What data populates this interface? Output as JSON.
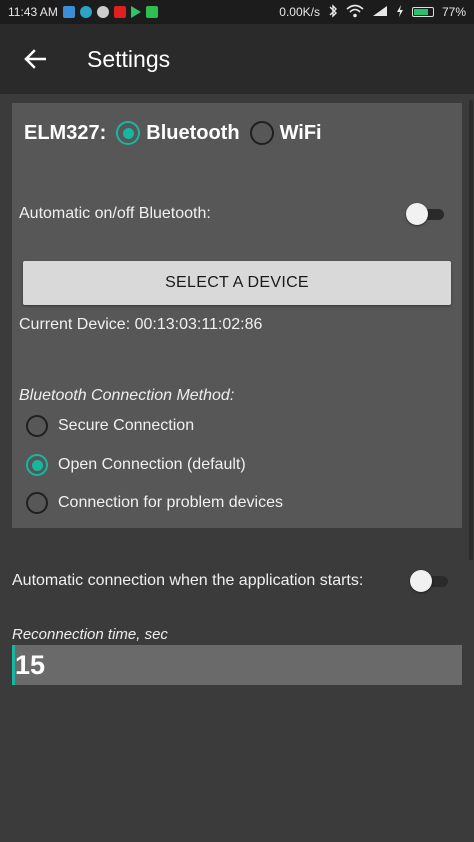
{
  "status_bar": {
    "time": "11:43 AM",
    "network_speed": "0.00K/s",
    "battery_percent": "77%",
    "battery_level": 0.77
  },
  "toolbar": {
    "title": "Settings",
    "back_icon": "arrow-left-icon"
  },
  "elm": {
    "label": "ELM327:",
    "options": [
      "Bluetooth",
      "WiFi"
    ],
    "selected": "Bluetooth"
  },
  "auto_bluetooth": {
    "label": "Automatic on/off Bluetooth:",
    "enabled": false
  },
  "select_device": {
    "label": "SELECT A DEVICE"
  },
  "current_device": {
    "text": "Current Device: 00:13:03:11:02:86"
  },
  "connection_method": {
    "label": "Bluetooth Connection Method:",
    "options": [
      {
        "label": "Secure Connection",
        "checked": false
      },
      {
        "label": "Open Connection (default)",
        "checked": true
      },
      {
        "label": "Connection for problem devices",
        "checked": false
      }
    ]
  },
  "auto_connect": {
    "label": "Automatic connection when the application starts:",
    "enabled": false
  },
  "reconnection": {
    "label": "Reconnection time, sec",
    "value": "15"
  },
  "colors": {
    "accent": "#17b6a0",
    "toolbar": "#2a2a2a",
    "panel": "#575757",
    "background": "#3b3b3b"
  }
}
